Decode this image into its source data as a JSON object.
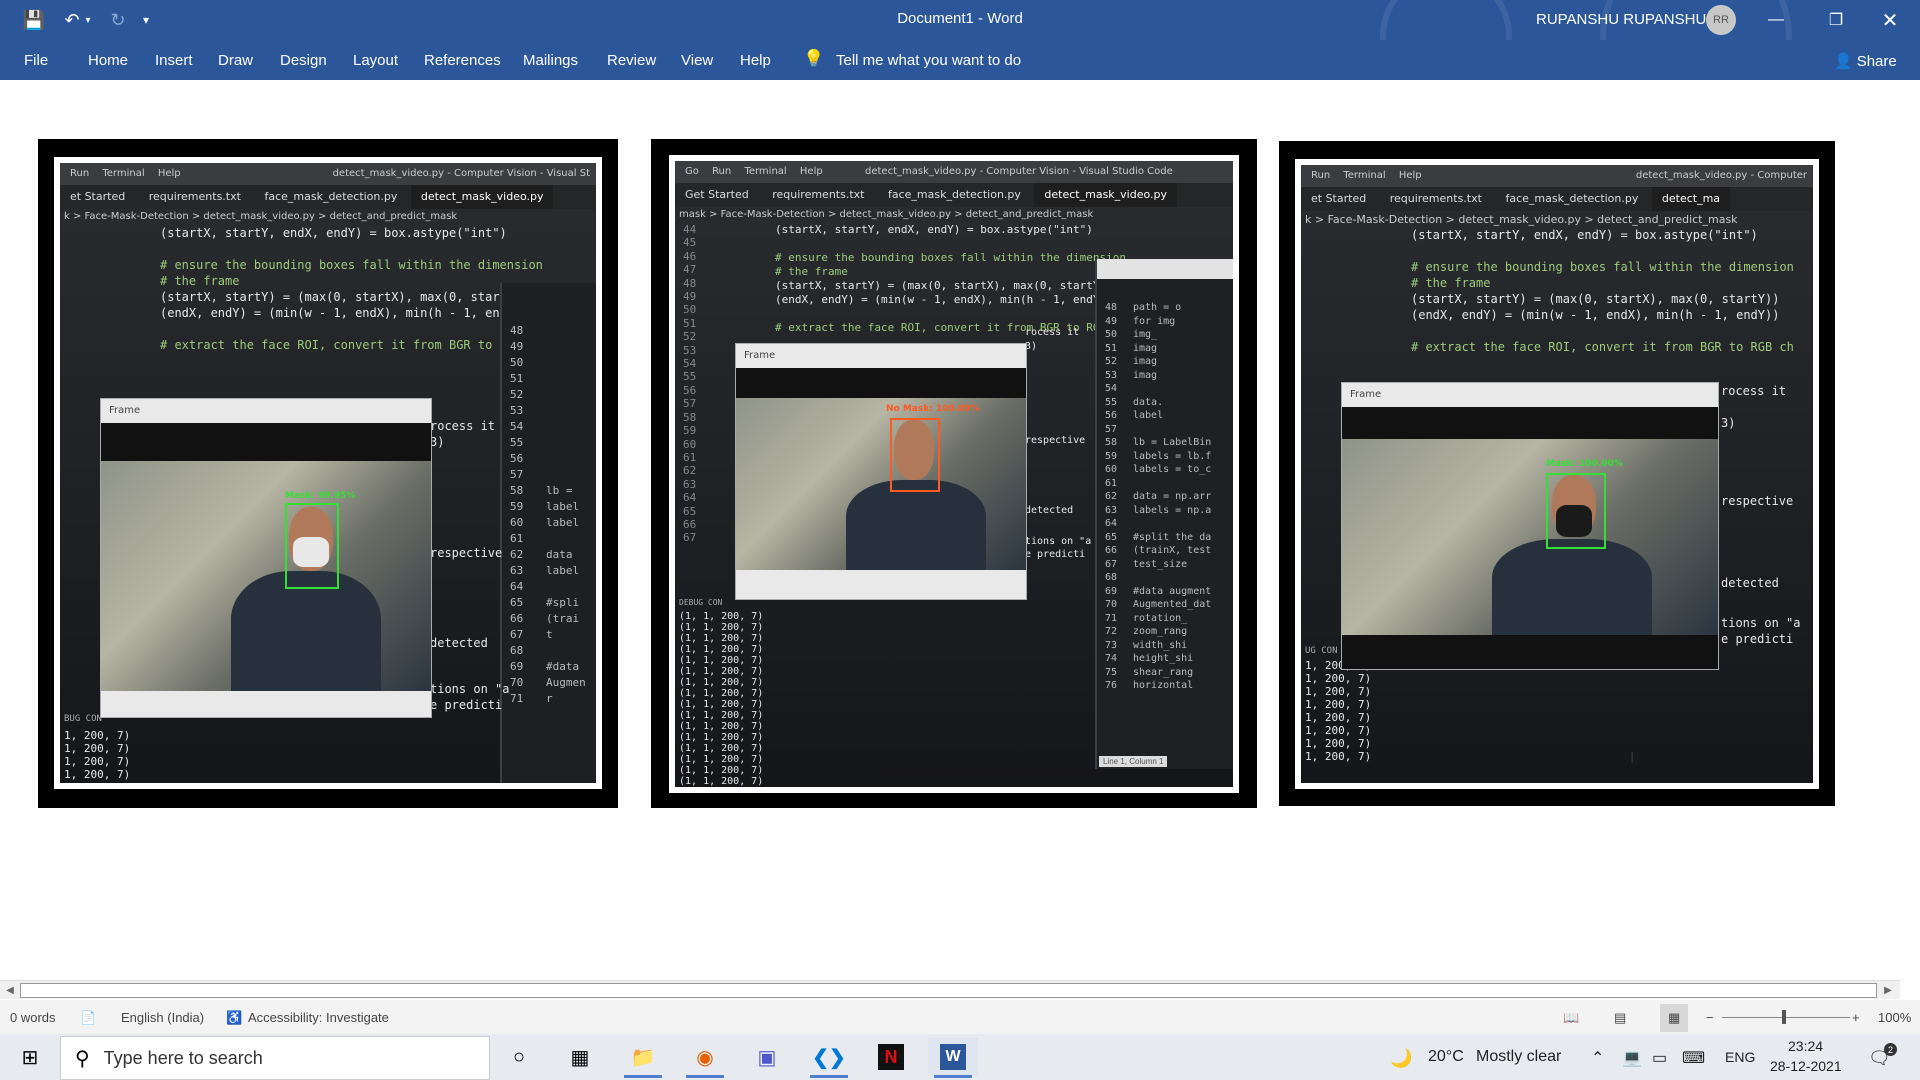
{
  "titlebar": {
    "document_title": "Document1  -  Word",
    "user_name": "RUPANSHU RUPANSHU",
    "user_initials": "RR"
  },
  "ribbon": {
    "tabs": [
      "File",
      "Home",
      "Insert",
      "Draw",
      "Design",
      "Layout",
      "References",
      "Mailings",
      "Review",
      "View",
      "Help"
    ],
    "tell_me": "Tell me what you want to do",
    "share": "Share"
  },
  "photos": [
    {
      "menu": [
        "Run",
        "Terminal",
        "Help"
      ],
      "window_title": "detect_mask_video.py - Computer Vision - Visual St",
      "tabs": [
        "et Started",
        "requirements.txt",
        "face_mask_detection.py",
        "detect_mask_video.py"
      ],
      "breadcrumb": "k > Face-Mask-Detection > detect_mask_video.py > detect_and_predict_mask",
      "code": [
        "(startX, startY, endX, endY) = box.astype(\"int\")",
        "",
        "# ensure the bounding boxes fall within the dimension",
        "# the frame",
        "(startX, startY) = (max(0, startX), max(0, startY))",
        "(endX, endY) = (min(w - 1, endX), min(h - 1, endY))",
        "",
        "# extract the face ROI, convert it from BGR to RGB ch"
      ],
      "frame_title": "Frame",
      "label": "Mask: 99.95%",
      "side_nums": [
        "48",
        "49",
        "50",
        "51",
        "52",
        "53",
        "54",
        "55",
        "56",
        "57",
        "58",
        "59",
        "60",
        "61",
        "62",
        "63",
        "64",
        "65",
        "66",
        "67",
        "68",
        "69",
        "70",
        "71"
      ],
      "side_code": [
        "lb =",
        "label",
        "label",
        "",
        "data",
        "label",
        "",
        "#spli",
        "(trai",
        "t",
        "",
        "#data",
        "Augmen",
        "r"
      ],
      "console": [
        "1, 200, 7)",
        "1, 200, 7)",
        "1, 200, 7)",
        "1, 200, 7)"
      ],
      "snips": [
        "rocess it",
        "3)",
        "respective",
        "detected",
        "tions on \"a",
        "e predicti",
        "BUG CON"
      ]
    },
    {
      "menu": [
        "Go",
        "Run",
        "Terminal",
        "Help"
      ],
      "window_title": "detect_mask_video.py - Computer Vision - Visual Studio Code",
      "tabs": [
        "Get Started",
        "requirements.txt",
        "face_mask_detection.py",
        "detect_mask_video.py"
      ],
      "breadcrumb": "mask > Face-Mask-Detection > detect_mask_video.py > detect_and_predict_mask",
      "line_nums": [
        "44",
        "45",
        "46",
        "47",
        "48",
        "49",
        "50",
        "51",
        "52",
        "53",
        "54",
        "55",
        "56",
        "57",
        "58",
        "59",
        "60",
        "61",
        "62",
        "63",
        "64",
        "65",
        "66",
        "67"
      ],
      "code": [
        "(startX, startY, endX, endY) = box.astype(\"int\")",
        "",
        "# ensure the bounding boxes fall within the dimension",
        "# the frame",
        "(startX, startY) = (max(0, startX), max(0, startY))",
        "(endX, endY) = (min(w - 1, endX), min(h - 1, endY))",
        "",
        "# extract the face ROI, convert it from BGR to RGB ch"
      ],
      "frame_title": "Frame",
      "label": "No Mask: 100.00%",
      "side_nums": [
        "48",
        "49",
        "50",
        "51",
        "52",
        "53",
        "54",
        "55",
        "56",
        "57",
        "58",
        "59",
        "60",
        "61",
        "62",
        "63",
        "64",
        "65",
        "66",
        "67",
        "68",
        "69",
        "70",
        "71",
        "72",
        "73",
        "74",
        "75",
        "76"
      ],
      "side_code": [
        "path = o",
        "for img",
        "img_",
        "imag",
        "imag",
        "imag",
        "",
        "data.",
        "label",
        "",
        "lb = LabelBin",
        "labels = lb.f",
        "labels = to_c",
        "",
        "data = np.arr",
        "labels = np.a",
        "",
        "#split the da",
        "(trainX, test",
        "test_size",
        "",
        "#data augment",
        "Augmented_dat",
        "rotation_",
        "zoom_rang",
        "width_shi",
        "height_shi",
        "shear_rang",
        "horizontal"
      ],
      "console": [
        "(1, 1, 200, 7)",
        "(1, 1, 200, 7)",
        "(1, 1, 200, 7)",
        "(1, 1, 200, 7)",
        "(1, 1, 200, 7)",
        "(1, 1, 200, 7)",
        "(1, 1, 200, 7)",
        "(1, 1, 200, 7)",
        "(1, 1, 200, 7)",
        "(1, 1, 200, 7)",
        "(1, 1, 200, 7)",
        "(1, 1, 200, 7)",
        "(1, 1, 200, 7)",
        "(1, 1, 200, 7)",
        "(1, 1, 200, 7)",
        "(1, 1, 200, 7)"
      ],
      "snips": [
        "rocess it",
        "3)",
        "respective",
        "detected",
        "tions on \"a",
        "e predicti",
        "DEBUG CON",
        "Line 1, Column 1"
      ]
    },
    {
      "menu": [
        "Run",
        "Terminal",
        "Help"
      ],
      "window_title": "detect_mask_video.py - Computer",
      "tabs": [
        "et Started",
        "requirements.txt",
        "face_mask_detection.py",
        "detect_ma"
      ],
      "breadcrumb": "k > Face-Mask-Detection > detect_mask_video.py > detect_and_predict_mask",
      "code": [
        "(startX, startY, endX, endY) = box.astype(\"int\")",
        "",
        "# ensure the bounding boxes fall within the dimension",
        "# the frame",
        "(startX, startY) = (max(0, startX), max(0, startY))",
        "(endX, endY) = (min(w - 1, endX), min(h - 1, endY))",
        "",
        "# extract the face ROI, convert it from BGR to RGB ch"
      ],
      "frame_title": "Frame",
      "label": "Mask: 100.00%",
      "console": [
        "1, 200, 7)",
        "1, 200, 7)",
        "1, 200, 7)",
        "1, 200, 7)",
        "1, 200, 7)",
        "1, 200, 7)",
        "1, 200, 7)",
        "1, 200, 7)"
      ],
      "snips": [
        "rocess it",
        "3)",
        "respective",
        "detected",
        "tions on \"a",
        "e predicti",
        "UG CON"
      ]
    }
  ],
  "statusbar": {
    "words": "0 words",
    "language": "English (India)",
    "accessibility": "Accessibility: Investigate",
    "zoom": "100%"
  },
  "taskbar": {
    "search_placeholder": "Type here to search",
    "weather_temp": "20°C",
    "weather_text": "Mostly clear",
    "language": "ENG",
    "time": "23:24",
    "date": "28-12-2021",
    "notifications": "2"
  },
  "colors": {
    "word_blue": "#2b579a",
    "mask_green": "#34e034",
    "nomask_red": "#ff5a1f"
  }
}
